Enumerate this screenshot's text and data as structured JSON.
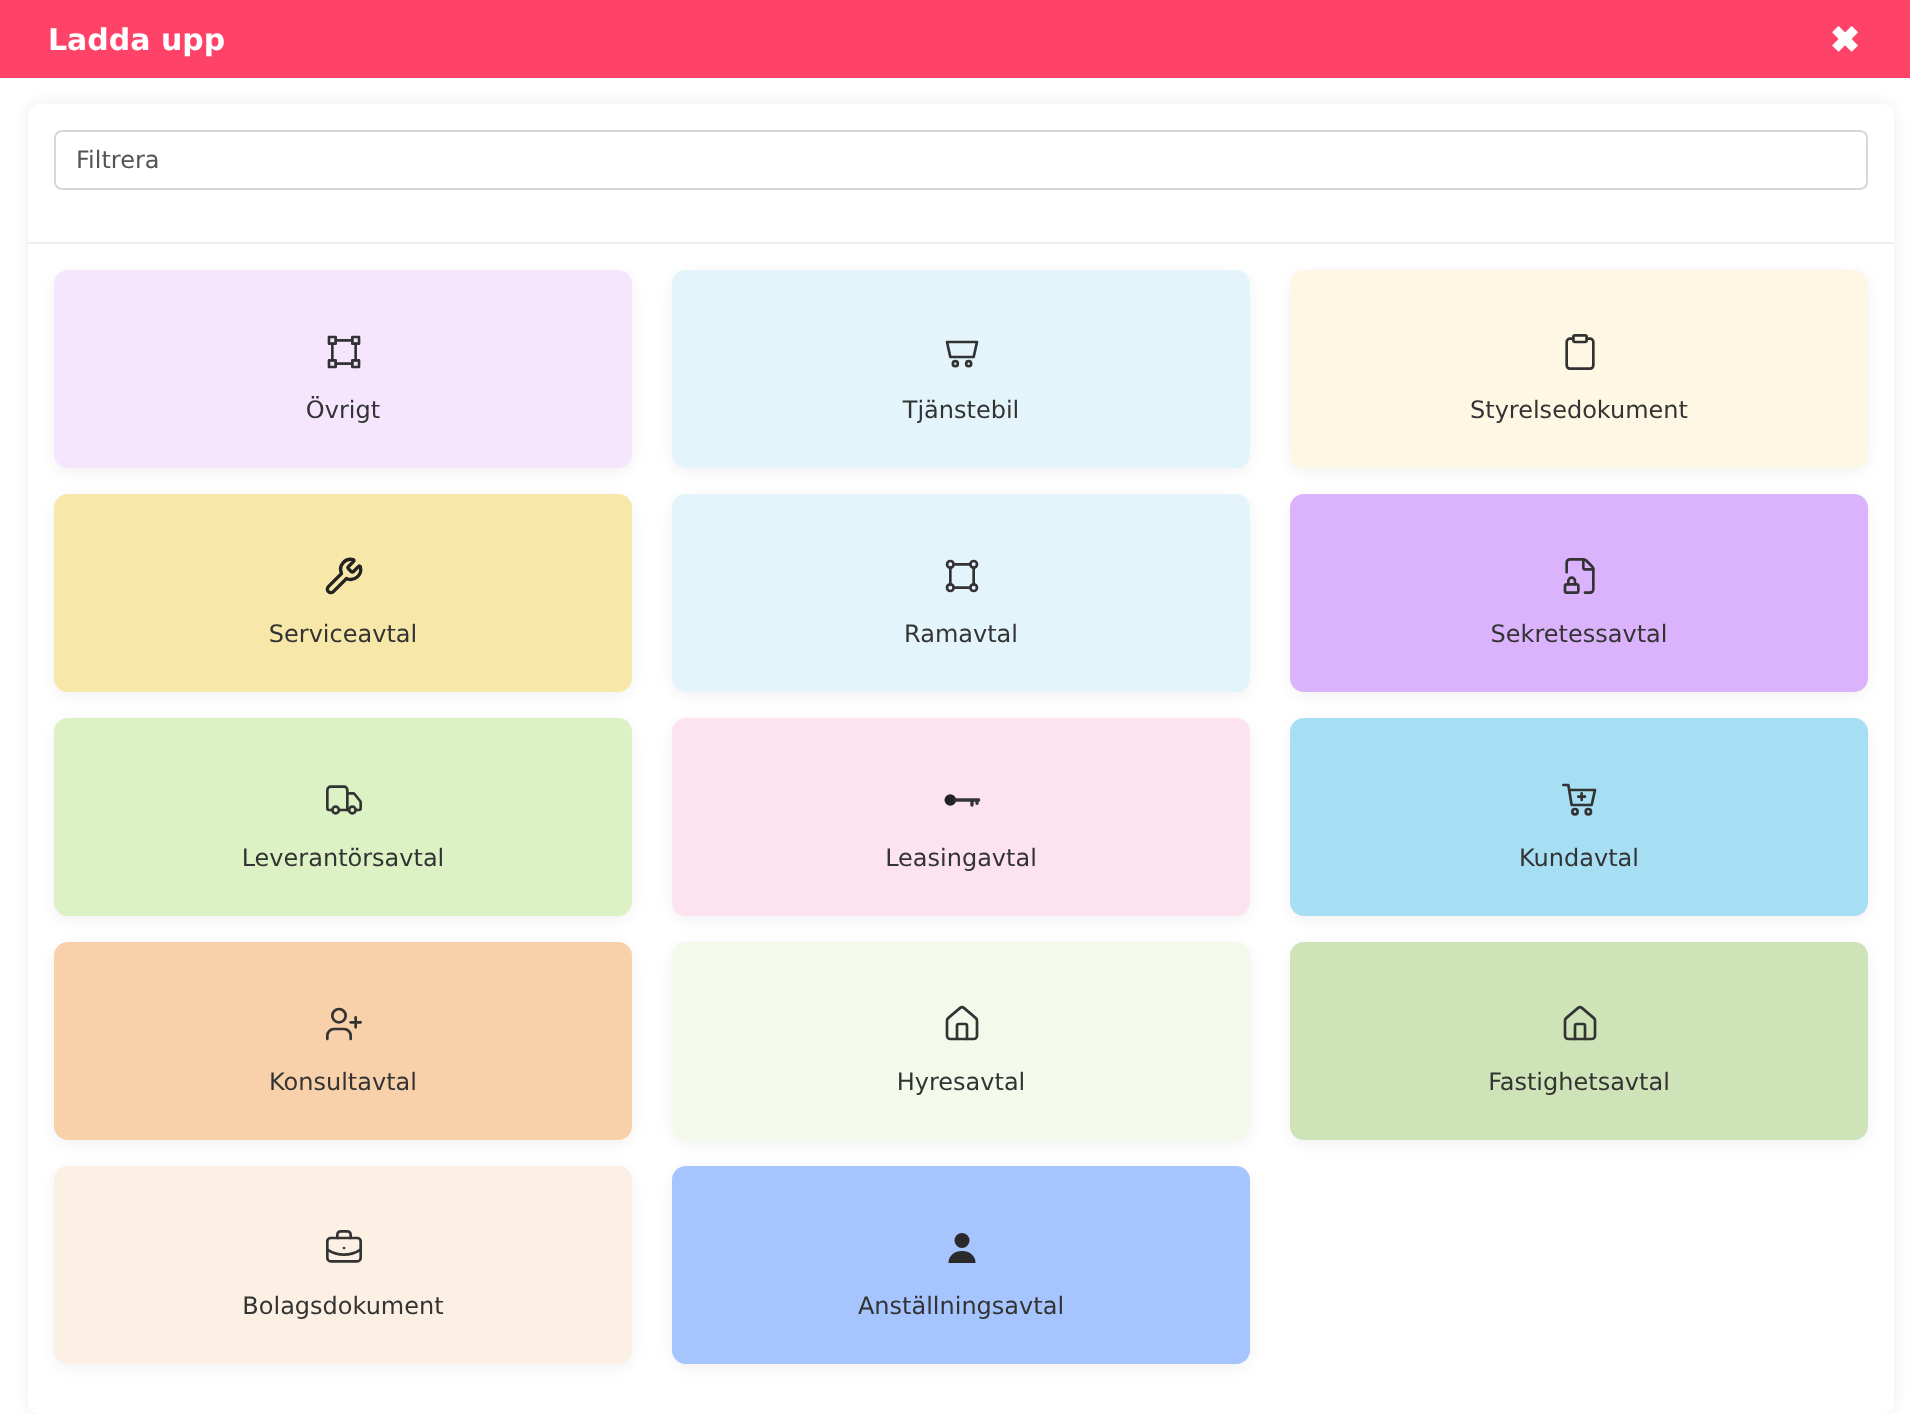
{
  "window": {
    "title": "Ladda upp",
    "close": "✖"
  },
  "filter": {
    "placeholder": "Filtrera"
  },
  "categories": [
    {
      "label": "Övrigt",
      "kind": "selection",
      "color": "#f5e6fe"
    },
    {
      "label": "Tjänstebil",
      "kind": "cart",
      "color": "#e3f4fb"
    },
    {
      "label": "Styrelsedokument",
      "kind": "clipboard",
      "color": "#fef7e4"
    },
    {
      "label": "Serviceavtal",
      "kind": "wrench",
      "color": "#f7e8a9"
    },
    {
      "label": "Ramavtal",
      "kind": "frame",
      "color": "#e3f4fb"
    },
    {
      "label": "Sekretessavtal",
      "kind": "filelock",
      "color": "#dbb3fd"
    },
    {
      "label": "Leverantörsavtal",
      "kind": "truck",
      "color": "#dcf2c4"
    },
    {
      "label": "Leasingavtal",
      "kind": "key",
      "color": "#fde3f0"
    },
    {
      "label": "Kundavtal",
      "kind": "cartplus",
      "color": "#a6dff4"
    },
    {
      "label": "Konsultavtal",
      "kind": "userplus",
      "color": "#f8d1ab"
    },
    {
      "label": "Hyresavtal",
      "kind": "house",
      "color": "#f3faec"
    },
    {
      "label": "Fastighetsavtal",
      "kind": "house",
      "color": "#cfe3b9"
    },
    {
      "label": "Bolagsdokument",
      "kind": "briefcase",
      "color": "#fcf0e4"
    },
    {
      "label": "Anställningsavtal",
      "kind": "user",
      "color": "#a6c4fd"
    }
  ]
}
